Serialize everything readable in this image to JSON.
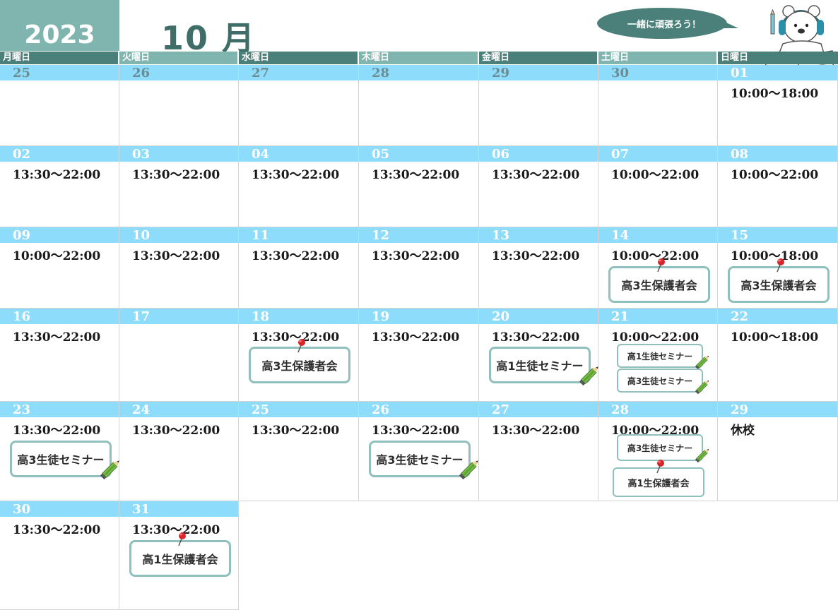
{
  "header": {
    "year": "2023",
    "month": "10 月",
    "speech_bubble": "一緒に頑張ろう！"
  },
  "weekdays": [
    "月曜日",
    "火曜日",
    "水曜日",
    "木曜日",
    "金曜日",
    "土曜日",
    "日曜日"
  ],
  "weeks": [
    [
      {
        "date": "25",
        "hours": ""
      },
      {
        "date": "26",
        "hours": ""
      },
      {
        "date": "27",
        "hours": ""
      },
      {
        "date": "28",
        "hours": ""
      },
      {
        "date": "29",
        "hours": ""
      },
      {
        "date": "30",
        "hours": ""
      },
      {
        "date": "01",
        "hours": "10:00～18:00"
      }
    ],
    [
      {
        "date": "02",
        "hours": "13:30～22:00"
      },
      {
        "date": "03",
        "hours": "13:30～22:00"
      },
      {
        "date": "04",
        "hours": "13:30～22:00"
      },
      {
        "date": "05",
        "hours": "13:30～22:00"
      },
      {
        "date": "06",
        "hours": "13:30～22:00"
      },
      {
        "date": "07",
        "hours": "10:00～22:00"
      },
      {
        "date": "08",
        "hours": "10:00～22:00"
      }
    ],
    [
      {
        "date": "09",
        "hours": "10:00～22:00"
      },
      {
        "date": "10",
        "hours": "13:30～22:00"
      },
      {
        "date": "11",
        "hours": "13:30～22:00"
      },
      {
        "date": "12",
        "hours": "13:30～22:00"
      },
      {
        "date": "13",
        "hours": "13:30～22:00"
      },
      {
        "date": "14",
        "hours": "10:00～22:00",
        "events": [
          {
            "label": "高3生保護者会",
            "kind": "pin"
          }
        ]
      },
      {
        "date": "15",
        "hours": "10:00～18:00",
        "events": [
          {
            "label": "高3生保護者会",
            "kind": "pin"
          }
        ]
      }
    ],
    [
      {
        "date": "16",
        "hours": "13:30～22:00"
      },
      {
        "date": "17",
        "hours": ""
      },
      {
        "date": "18",
        "hours": "13:30～22:00",
        "events": [
          {
            "label": "高3生保護者会",
            "kind": "pin"
          }
        ]
      },
      {
        "date": "19",
        "hours": "13:30～22:00"
      },
      {
        "date": "20",
        "hours": "13:30～22:00",
        "events": [
          {
            "label": "高1生徒セミナー",
            "kind": "pencil"
          }
        ]
      },
      {
        "date": "21",
        "hours": "10:00～22:00",
        "events": [
          {
            "label": "高1生徒セミナー",
            "kind": "pencil"
          },
          {
            "label": "高3生徒セミナー",
            "kind": "pencil"
          }
        ]
      },
      {
        "date": "22",
        "hours": "10:00～18:00"
      }
    ],
    [
      {
        "date": "23",
        "hours": "13:30～22:00",
        "events": [
          {
            "label": "高3生徒セミナー",
            "kind": "pencil"
          }
        ]
      },
      {
        "date": "24",
        "hours": "13:30～22:00"
      },
      {
        "date": "25",
        "hours": "13:30～22:00"
      },
      {
        "date": "26",
        "hours": "13:30～22:00",
        "events": [
          {
            "label": "高3生徒セミナー",
            "kind": "pencil"
          }
        ]
      },
      {
        "date": "27",
        "hours": "13:30～22:00"
      },
      {
        "date": "28",
        "hours": "10:00～22:00",
        "events": [
          {
            "label": "高3生徒セミナー",
            "kind": "pencil"
          },
          {
            "label": "高1生保護者会",
            "kind": "pin"
          }
        ]
      },
      {
        "date": "29",
        "hours": "休校"
      }
    ],
    [
      {
        "date": "30",
        "hours": "13:30～22:00"
      },
      {
        "date": "31",
        "hours": "13:30～22:00",
        "events": [
          {
            "label": "高1生保護者会",
            "kind": "pin"
          }
        ]
      }
    ]
  ],
  "colors": {
    "year_bg": "#7fb5ae",
    "weekday_bg": "#4a8079",
    "date_bar": "#8edcfb",
    "event_border": "#8fc0bc",
    "bubble": "#4a8079"
  }
}
